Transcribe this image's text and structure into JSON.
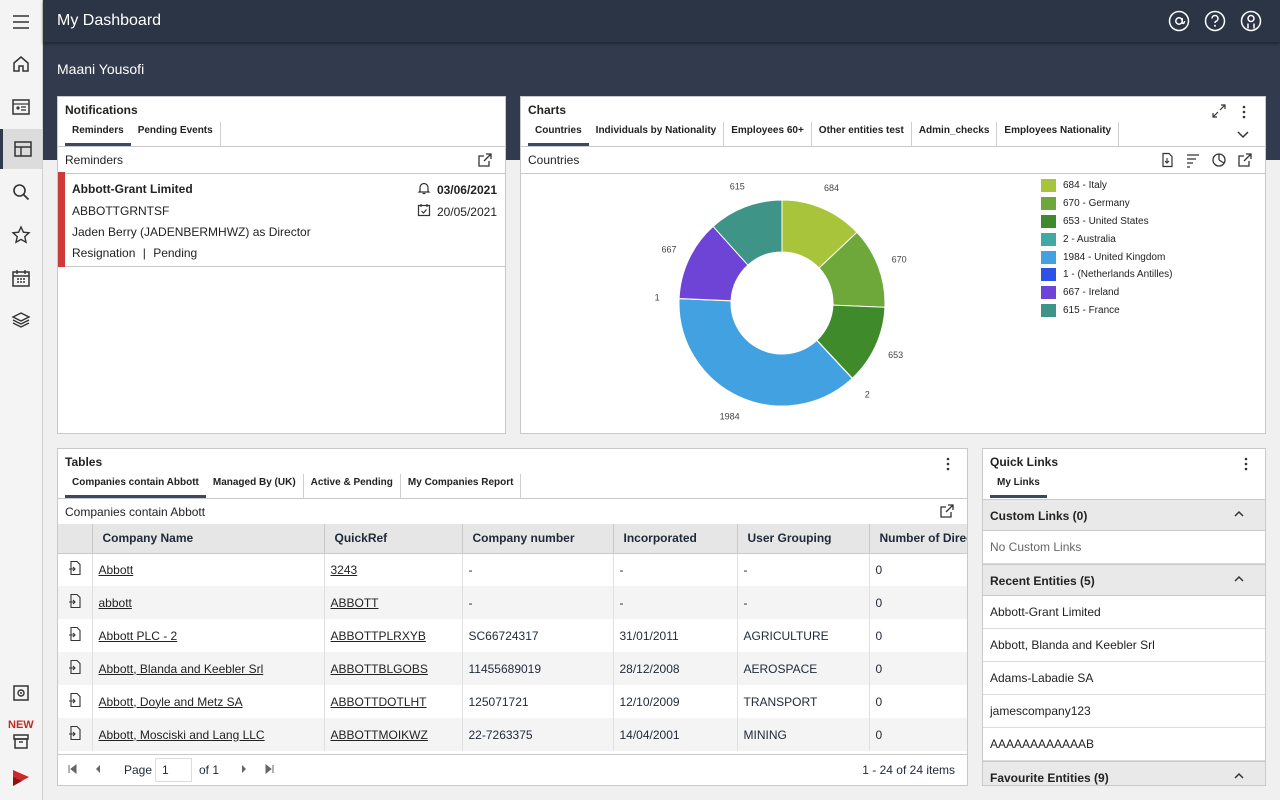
{
  "header": {
    "title": "My Dashboard",
    "user_name": "Maani Yousofi"
  },
  "rail": {
    "new_label": "NEW"
  },
  "notifications": {
    "title": "Notifications",
    "tabs": [
      "Reminders",
      "Pending Events"
    ],
    "sub_title": "Reminders",
    "reminder": {
      "company": "Abbott-Grant Limited",
      "ref": "ABBOTTGRNTSF",
      "person": "Jaden Berry (JADENBERMHWZ) as Director",
      "event": "Resignation",
      "separator": "|",
      "status": "Pending",
      "due_date": "03/06/2021",
      "created_date": "20/05/2021"
    }
  },
  "charts": {
    "title": "Charts",
    "tabs": [
      "Countries",
      "Individuals by Nationality",
      "Employees 60+",
      "Other entities test",
      "Admin_checks",
      "Employees Nationality"
    ],
    "sub_title": "Countries"
  },
  "chart_data": {
    "type": "pie",
    "title": "Countries",
    "labels": [
      "Italy",
      "Germany",
      "United States",
      "Australia",
      "United Kingdom",
      "(Netherlands Antilles)",
      "Ireland",
      "France"
    ],
    "values": [
      684,
      670,
      653,
      2,
      1984,
      1,
      667,
      615
    ],
    "legend": [
      "684 - Italy",
      "670 - Germany",
      "653 - United States",
      "2 - Australia",
      "1984 - United Kingdom",
      "1 - (Netherlands Antilles)",
      "667 - Ireland",
      "615 - France"
    ],
    "colors": [
      "#a8c43a",
      "#6fa83a",
      "#3f8a2a",
      "#41a9a3",
      "#42a1e0",
      "#2d53e6",
      "#6e44d6",
      "#3f9488"
    ],
    "donut": true,
    "legend_position": "right"
  },
  "tables": {
    "title": "Tables",
    "tabs": [
      "Companies contain Abbott",
      "Managed By (UK)",
      "Active & Pending",
      "My Companies Report"
    ],
    "sub_title": "Companies contain Abbott",
    "columns": [
      "Company Name",
      "QuickRef",
      "Company number",
      "Incorporated",
      "User Grouping",
      "Number of Directors"
    ],
    "rows": [
      [
        "Abbott",
        "3243",
        "-",
        "-",
        "-",
        "0"
      ],
      [
        "abbott",
        "ABBOTT",
        "-",
        "-",
        "-",
        "0"
      ],
      [
        "Abbott PLC - 2",
        "ABBOTTPLRXYB",
        "SC66724317",
        "31/01/2011",
        "AGRICULTURE",
        "0"
      ],
      [
        "Abbott, Blanda and Keebler Srl",
        "ABBOTTBLGOBS",
        "11455689019",
        "28/12/2008",
        "AEROSPACE",
        "0"
      ],
      [
        "Abbott, Doyle and Metz SA",
        "ABBOTTDOTLHT",
        "125071721",
        "12/10/2009",
        "TRANSPORT",
        "0"
      ],
      [
        "Abbott, Mosciski and Lang LLC",
        "ABBOTTMOIKWZ",
        "22-7263375",
        "14/04/2001",
        "MINING",
        "0"
      ]
    ],
    "pager": {
      "page_label": "Page",
      "page_value": "1",
      "of_label": "of 1",
      "summary": "1 - 24 of 24 items"
    }
  },
  "quick_links": {
    "title": "Quick Links",
    "tabs": [
      "My Links"
    ],
    "custom": {
      "label": "Custom Links (0)",
      "empty": "No Custom Links"
    },
    "recent": {
      "label": "Recent Entities (5)",
      "items": [
        "Abbott-Grant Limited",
        "Abbott, Blanda and Keebler Srl",
        "Adams-Labadie SA",
        "jamescompany123",
        "AAAAAAAAAAAAB"
      ]
    },
    "favourite": {
      "label": "Favourite Entities (9)"
    }
  }
}
